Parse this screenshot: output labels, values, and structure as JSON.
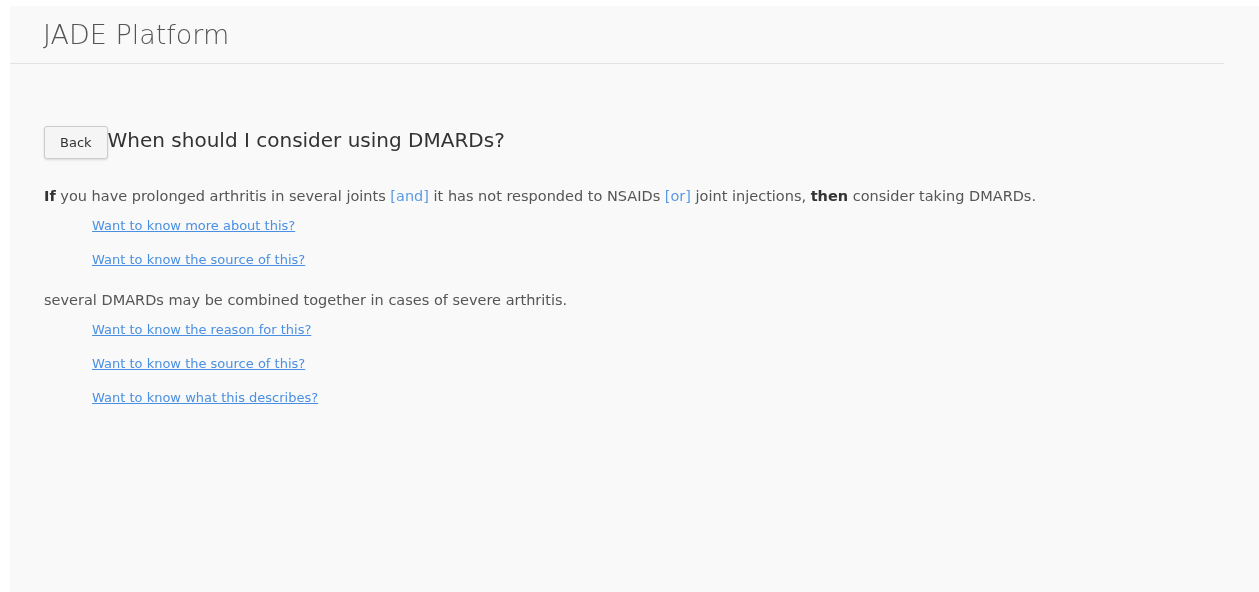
{
  "header": {
    "title": "JADE Platform"
  },
  "back_button": "Back",
  "question": "When should I consider using DMARDs?",
  "statements": [
    {
      "segments": [
        {
          "kind": "keyword",
          "text": "If"
        },
        {
          "kind": "text",
          "text": " you have prolonged arthritis in several joints "
        },
        {
          "kind": "operator",
          "text": "[and]"
        },
        {
          "kind": "text",
          "text": " it has not responded to NSAIDs "
        },
        {
          "kind": "operator",
          "text": "[or]"
        },
        {
          "kind": "text",
          "text": " joint injections, "
        },
        {
          "kind": "keyword",
          "text": "then"
        },
        {
          "kind": "text",
          "text": " consider taking DMARDs."
        }
      ],
      "links": [
        "Want to know more about this?",
        "Want to know the source of this?"
      ]
    },
    {
      "segments": [
        {
          "kind": "text",
          "text": "several DMARDs may be combined together in cases of severe arthritis."
        }
      ],
      "links": [
        "Want to know the reason for this?",
        "Want to know the source of this?",
        "Want to know what this describes?"
      ]
    }
  ]
}
